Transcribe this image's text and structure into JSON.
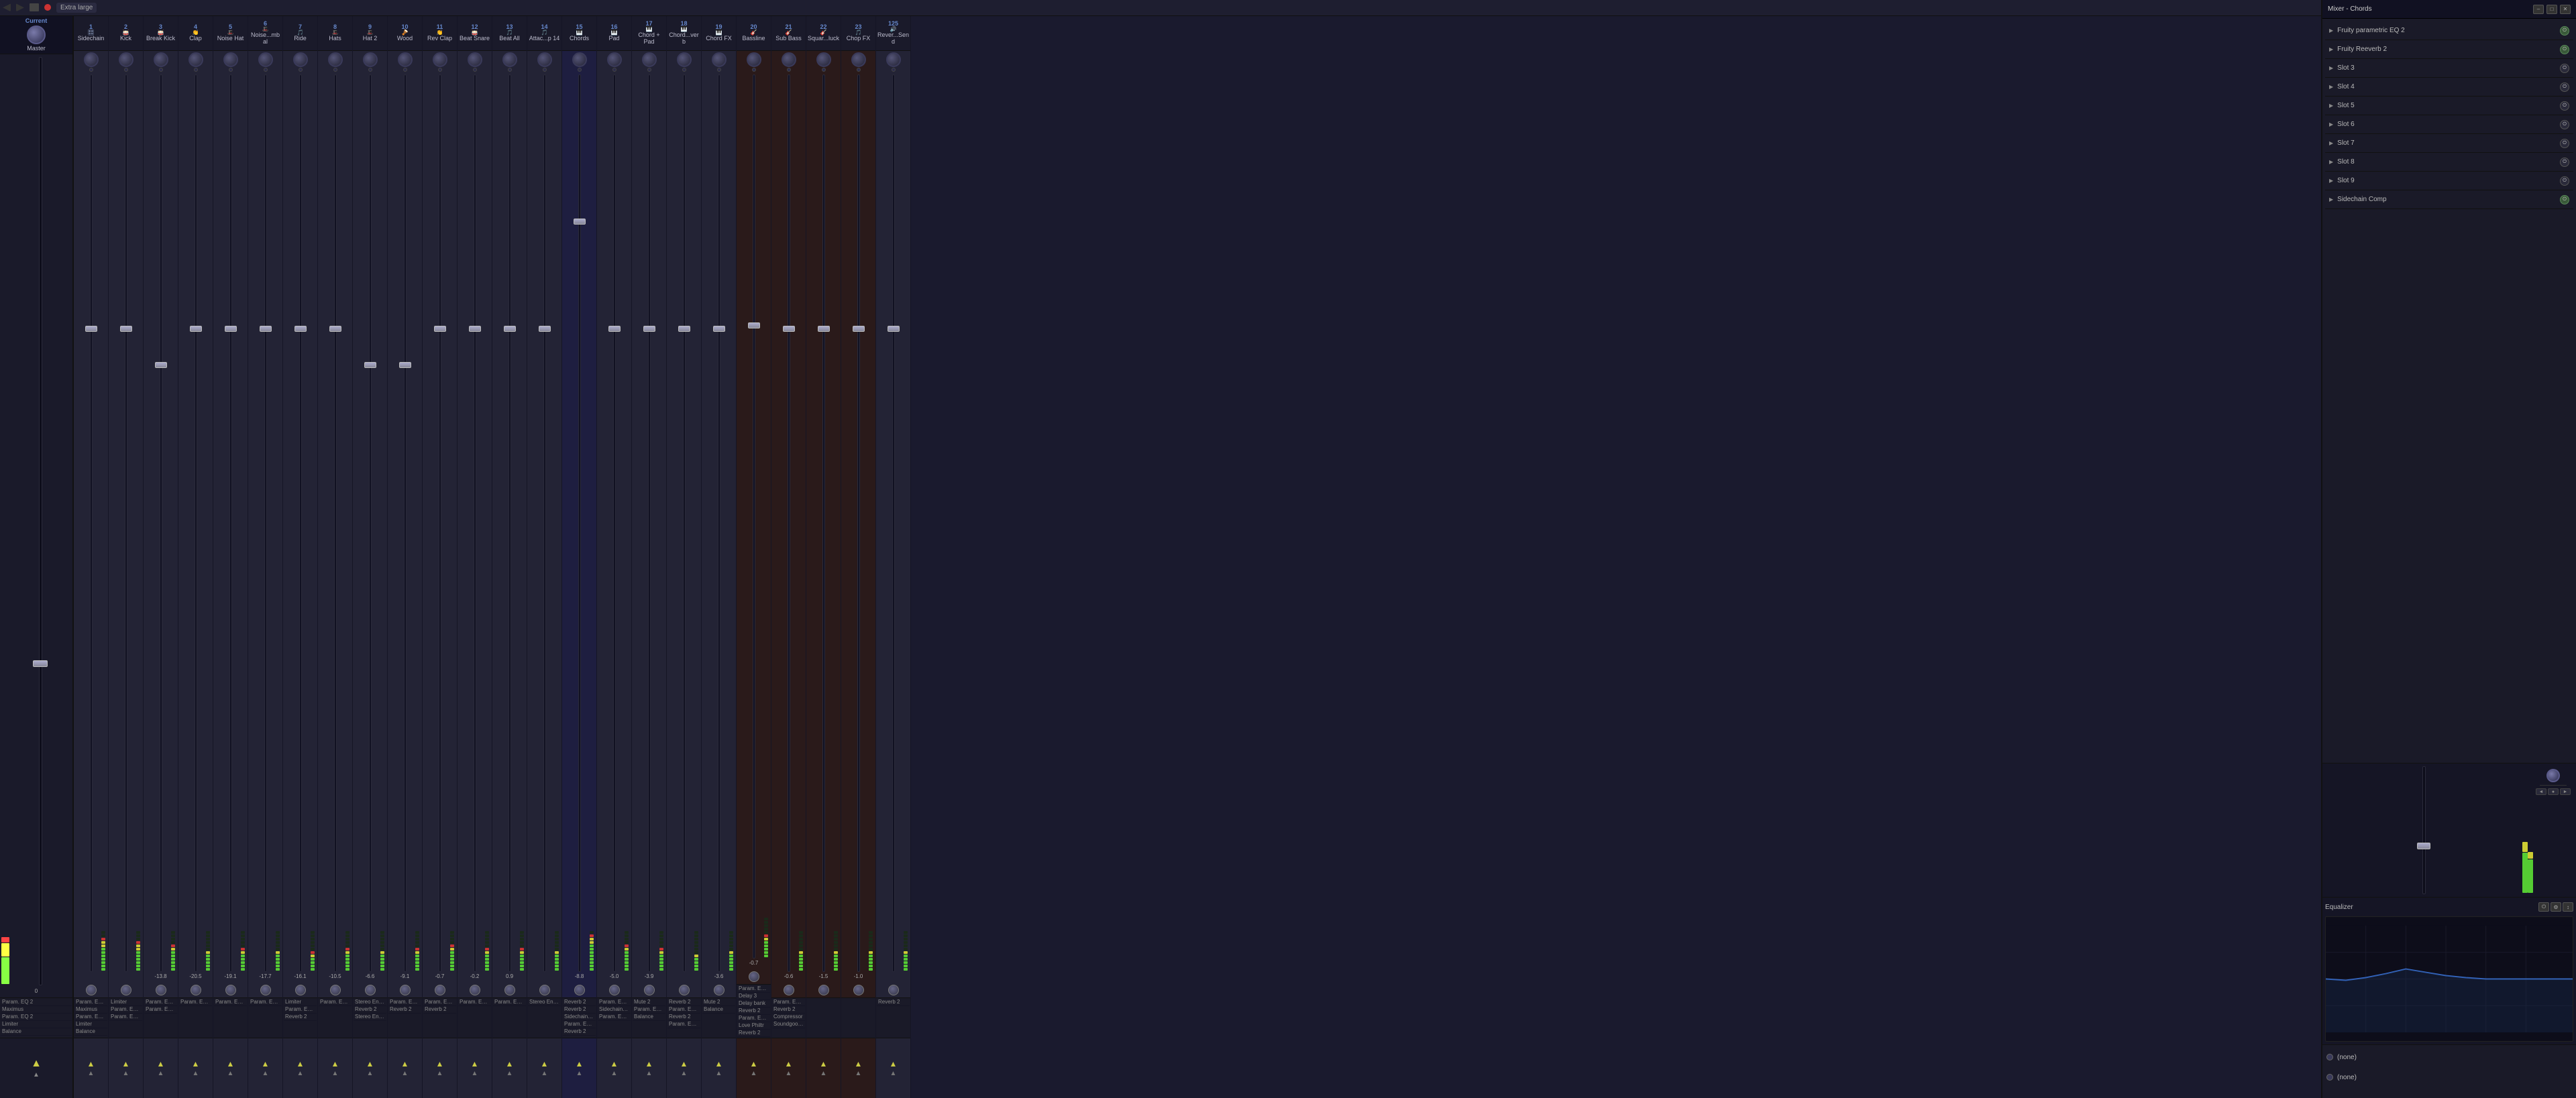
{
  "app": {
    "title": "Mixer - Chords",
    "toolbar": {
      "size_label": "Extra large",
      "icons": [
        "back-icon",
        "forward-icon",
        "step-icon",
        "record-icon"
      ]
    }
  },
  "mixer": {
    "current_label": "Current",
    "master_label": "Master",
    "channels": [
      {
        "num": 1,
        "name": "Sidechain",
        "icon": "🎛",
        "level": "",
        "inserts": [
          "Param. EQ 2",
          "Maximus",
          "Param. EQ 2",
          "Limiter",
          "Balance"
        ]
      },
      {
        "num": 2,
        "name": "Kick",
        "icon": "🥁",
        "level": "",
        "inserts": [
          "Limiter",
          "Param. EQ 2",
          "Param. EQ 2"
        ]
      },
      {
        "num": 3,
        "name": "Break Kick",
        "icon": "🥁",
        "level": "-13.8",
        "inserts": [
          "Param. EQ 2",
          "Param. EQ 2"
        ]
      },
      {
        "num": 4,
        "name": "Clap",
        "icon": "👏",
        "level": "-20.5",
        "inserts": [
          "Param. EQ 2"
        ]
      },
      {
        "num": 5,
        "name": "Noise Hat",
        "icon": "🎩",
        "level": "-19.1",
        "inserts": [
          "Param. EQ 2"
        ]
      },
      {
        "num": 6,
        "name": "Noise...mbal",
        "icon": "🎩",
        "level": "-17.7",
        "inserts": [
          "Param. EQ 2"
        ]
      },
      {
        "num": 7,
        "name": "Ride",
        "icon": "🎵",
        "level": "-16.1",
        "inserts": [
          "Limiter",
          "Param. EQ 2",
          "Reverb 2"
        ]
      },
      {
        "num": 8,
        "name": "Hats",
        "icon": "🎩",
        "level": "-10.5",
        "inserts": [
          "Param. EQ 2"
        ]
      },
      {
        "num": 9,
        "name": "Hat 2",
        "icon": "🎩",
        "level": "-6.6",
        "inserts": [
          "Stereo Enhancer",
          "Reverb 2",
          "Stereo Enhancer"
        ]
      },
      {
        "num": 10,
        "name": "Wood",
        "icon": "🪘",
        "level": "-9.1",
        "inserts": [
          "Param. EQ 2",
          "Reverb 2"
        ]
      },
      {
        "num": 11,
        "name": "Rev Clap",
        "icon": "👏",
        "level": "-0.7",
        "inserts": [
          "Param. EQ 2",
          "Reverb 2"
        ]
      },
      {
        "num": 12,
        "name": "Beat Snare",
        "icon": "🥁",
        "level": "-0.2",
        "inserts": [
          "Param. EQ 2"
        ]
      },
      {
        "num": 13,
        "name": "Beat All",
        "icon": "🎵",
        "level": "0.9",
        "inserts": [
          "Param. EQ 2"
        ]
      },
      {
        "num": 14,
        "name": "Attac...p 14",
        "icon": "🎵",
        "level": "",
        "inserts": [
          "Stereo Enhancer"
        ]
      },
      {
        "num": 15,
        "name": "Chords",
        "icon": "🎹",
        "level": "-8.8",
        "inserts": [
          "Reverb 2",
          "Reverb 2",
          "Sidechain Comp",
          "Param. EQ 2",
          "Reverb 2"
        ]
      },
      {
        "num": 16,
        "name": "Pad",
        "icon": "🎹",
        "level": "-5.0",
        "inserts": [
          "Param. EQ 2",
          "Sidechain Comp",
          "Param. EQ 2"
        ]
      },
      {
        "num": 17,
        "name": "Chord + Pad",
        "icon": "🎹",
        "level": "-3.9",
        "inserts": [
          "Mute 2",
          "Param. EQ 2",
          "Balance"
        ]
      },
      {
        "num": 18,
        "name": "Chord...verb",
        "icon": "🎹",
        "level": "",
        "inserts": [
          "Reverb 2",
          "Param. EQ 2",
          "Reverb 2",
          "Param. EQ 2"
        ]
      },
      {
        "num": 19,
        "name": "Chord FX",
        "icon": "🎹",
        "level": "-3.6",
        "inserts": [
          "Mute 2",
          "Balance"
        ]
      },
      {
        "num": 20,
        "name": "Bassline",
        "icon": "🎸",
        "level": "-0.7",
        "inserts": [
          "Param. EQ 2",
          "Delay 3",
          "Delay bank",
          "Reverb 2",
          "Param. EQ 2",
          "Love Philtr",
          "Reverb 2"
        ]
      },
      {
        "num": 21,
        "name": "Sub Bass",
        "icon": "🎸",
        "level": "-0.6",
        "inserts": [
          "Param. EQ 2",
          "Reverb 2",
          "Compressor",
          "Soundgoodizer"
        ]
      },
      {
        "num": 22,
        "name": "Squar...luck",
        "icon": "🎸",
        "level": "-1.5",
        "inserts": []
      },
      {
        "num": 23,
        "name": "Chop FX",
        "icon": "🎵",
        "level": "-1.0",
        "inserts": []
      },
      {
        "num": "125",
        "name": "Rever...Send",
        "icon": "🔊",
        "level": "",
        "inserts": [
          "Reverb 2"
        ]
      }
    ]
  },
  "right_panel": {
    "title": "Mixer - Chords",
    "plugin_slots": [
      {
        "name": "Fruity parametric EQ 2",
        "enabled": true
      },
      {
        "name": "Fruity Reeverb 2",
        "enabled": true
      },
      {
        "name": "Slot 3",
        "enabled": false
      },
      {
        "name": "Slot 4",
        "enabled": false
      },
      {
        "name": "Slot 5",
        "enabled": false
      },
      {
        "name": "Slot 6",
        "enabled": false
      },
      {
        "name": "Slot 7",
        "enabled": false
      },
      {
        "name": "Slot 8",
        "enabled": false
      },
      {
        "name": "Slot 9",
        "enabled": false
      },
      {
        "name": "Sidechain Comp",
        "enabled": true
      }
    ],
    "equalizer_label": "Equalizer",
    "sends": [
      {
        "name": "(none)",
        "active": false
      },
      {
        "name": "(none)",
        "active": false
      }
    ]
  }
}
